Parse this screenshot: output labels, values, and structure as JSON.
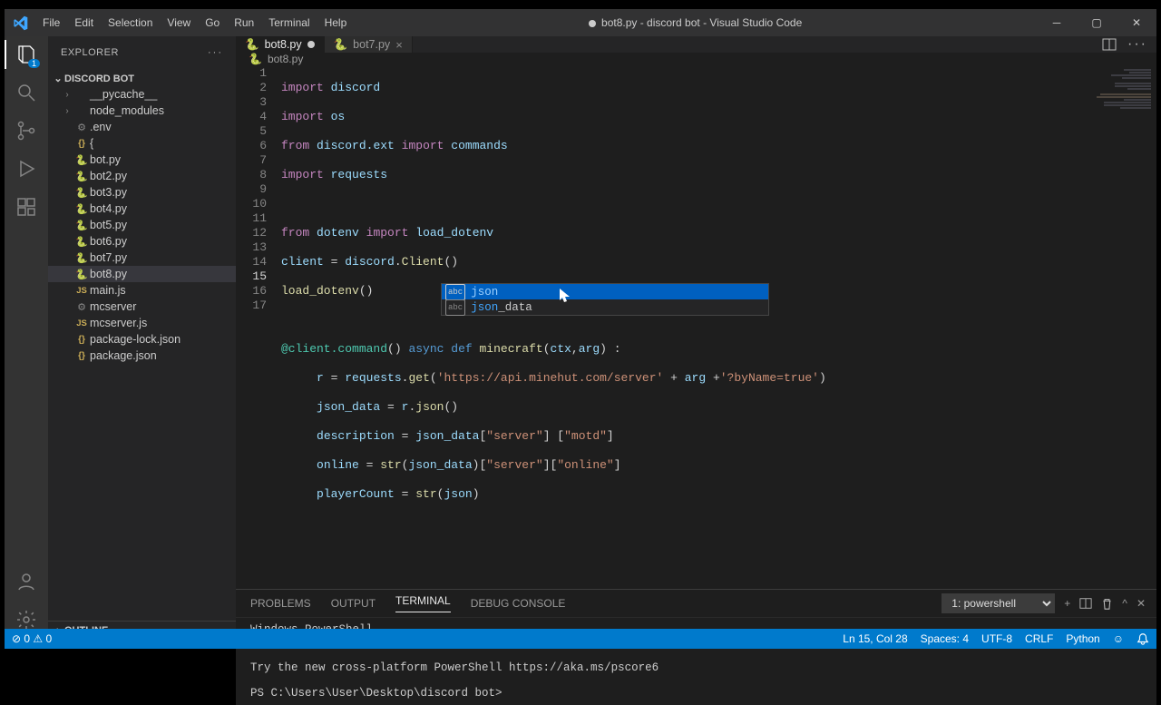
{
  "titlebar": {
    "menu": [
      "File",
      "Edit",
      "Selection",
      "View",
      "Go",
      "Run",
      "Terminal",
      "Help"
    ],
    "title": "bot8.py - discord bot - Visual Studio Code",
    "modified": true
  },
  "activitybar": {
    "explorer_badge": "1"
  },
  "sidebar": {
    "header": "EXPLORER",
    "root": "DISCORD BOT",
    "outline": "OUTLINE",
    "files": [
      {
        "type": "folder",
        "name": "__pycache__",
        "collapsed": true
      },
      {
        "type": "folder",
        "name": "node_modules",
        "collapsed": true
      },
      {
        "type": "env",
        "name": ".env"
      },
      {
        "type": "json",
        "name": "{"
      },
      {
        "type": "py",
        "name": "bot.py"
      },
      {
        "type": "py",
        "name": "bot2.py"
      },
      {
        "type": "py",
        "name": "bot3.py"
      },
      {
        "type": "py",
        "name": "bot4.py"
      },
      {
        "type": "py",
        "name": "bot5.py"
      },
      {
        "type": "py",
        "name": "bot6.py"
      },
      {
        "type": "py",
        "name": "bot7.py"
      },
      {
        "type": "py",
        "name": "bot8.py",
        "selected": true
      },
      {
        "type": "js",
        "name": "main.js"
      },
      {
        "type": "env",
        "name": "mcserver"
      },
      {
        "type": "js",
        "name": "mcserver.js"
      },
      {
        "type": "json",
        "name": "package-lock.json"
      },
      {
        "type": "json",
        "name": "package.json"
      }
    ]
  },
  "tabs": {
    "items": [
      {
        "name": "bot8.py",
        "active": true,
        "modified": true
      },
      {
        "name": "bot7.py",
        "active": false,
        "modified": false
      }
    ]
  },
  "breadcrumb": {
    "file": "bot8.py"
  },
  "code": {
    "lines": 17,
    "currentLine": 15
  },
  "autocomplete": {
    "items": [
      {
        "kind": "abc",
        "prefix": "json",
        "rest": ""
      },
      {
        "kind": "abc",
        "prefix": "json",
        "rest": "_data"
      }
    ],
    "selectedIndex": 0
  },
  "panel": {
    "tabs": [
      "PROBLEMS",
      "OUTPUT",
      "TERMINAL",
      "DEBUG CONSOLE"
    ],
    "activeTab": "TERMINAL",
    "terminalName": "1: powershell",
    "content": "Windows PowerShell\nCopyright (C) Microsoft Corporation. All rights reserved.\n\nTry the new cross-platform PowerShell https://aka.ms/pscore6\n\nPS C:\\Users\\User\\Desktop\\discord bot>"
  },
  "statusbar": {
    "errors": "0",
    "warnings": "0",
    "lncol": "Ln 15, Col 28",
    "spaces": "Spaces: 4",
    "encoding": "UTF-8",
    "eol": "CRLF",
    "lang": "Python",
    "feedback": "☺"
  }
}
